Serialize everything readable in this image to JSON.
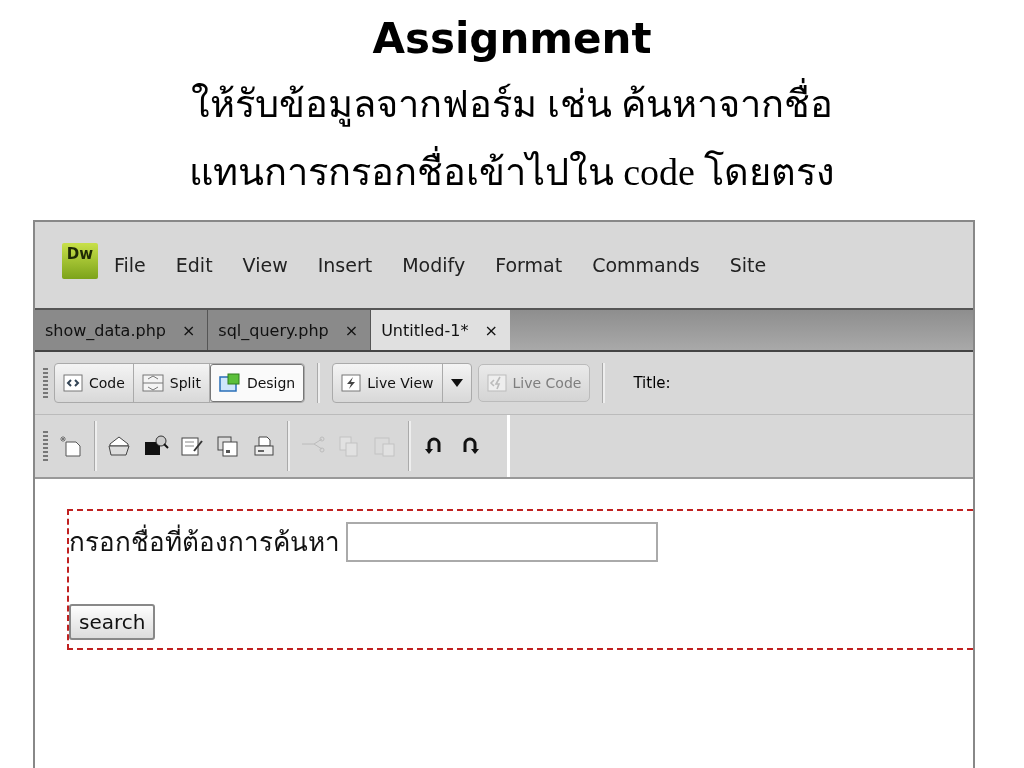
{
  "slide": {
    "title": "Assignment",
    "lines": [
      "ให้รับข้อมูลจากฟอร์ม เช่น ค้นหาจากชื่อ",
      "แทนการกรอกชื่อเข้าไปใน code โดยตรง"
    ]
  },
  "app": {
    "logo": "Dw",
    "menu": [
      "File",
      "Edit",
      "View",
      "Insert",
      "Modify",
      "Format",
      "Commands",
      "Site"
    ]
  },
  "tabs": [
    {
      "label": "show_data.php",
      "close": "×",
      "selected": false
    },
    {
      "label": "sql_query.php",
      "close": "×",
      "selected": false
    },
    {
      "label": "Untitled-1*",
      "close": "×",
      "selected": true
    }
  ],
  "view_buttons": [
    {
      "kind": "code",
      "label": "Code",
      "selected": false
    },
    {
      "kind": "split",
      "label": "Split",
      "selected": false
    },
    {
      "kind": "design",
      "label": "Design",
      "selected": true
    }
  ],
  "live_view": {
    "label": "Live View"
  },
  "live_code": {
    "label": "Live Code",
    "disabled": true
  },
  "title_label": "Title:",
  "tools": [
    {
      "kind": "new",
      "disabled": false
    },
    {
      "kind": "sep"
    },
    {
      "kind": "open",
      "disabled": false
    },
    {
      "kind": "browse",
      "disabled": false
    },
    {
      "kind": "edit",
      "disabled": false
    },
    {
      "kind": "saveall",
      "disabled": false
    },
    {
      "kind": "print",
      "disabled": false
    },
    {
      "kind": "sep"
    },
    {
      "kind": "cut",
      "disabled": true
    },
    {
      "kind": "copy",
      "disabled": true
    },
    {
      "kind": "paste",
      "disabled": true
    },
    {
      "kind": "sep"
    },
    {
      "kind": "undo",
      "disabled": false
    },
    {
      "kind": "redo",
      "disabled": false
    }
  ],
  "form": {
    "label": "กรอกชื่อที่ต้องการค้นหา",
    "button": "search"
  }
}
